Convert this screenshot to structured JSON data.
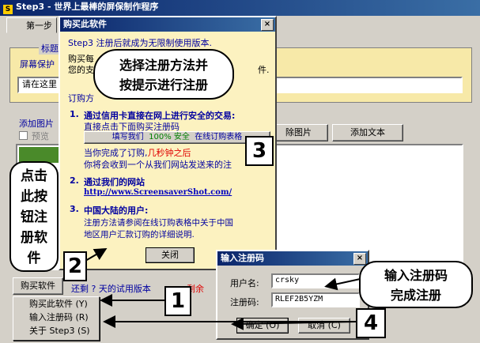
{
  "main_window": {
    "title": "Step3 - 世界上最棒的屏保制作程序",
    "step_tab": "第一步",
    "group_label": "标题",
    "saver_label": "屏幕保护",
    "title_input_value": "请在这里",
    "add_image_label": "添加图片",
    "preview_checkbox_label": "预览",
    "delete_image_button": "除图片",
    "add_text_button": "添加文本",
    "buy_button": "购买软件",
    "trial_text": "还剩 ? 天的试用版本",
    "trial_suffix": "剩余"
  },
  "buy_dialog": {
    "title": "购买此软件",
    "intro": "Step3 注册后就成为无限制使用版本.",
    "buy_line1": "购买每",
    "buy_line2": "您的支",
    "buy_line2_end": "件.",
    "methods_label": "订购方",
    "item1_num": "1.",
    "item1_title": "通过信用卡直接在网上进行安全的交易:",
    "item1_sub": "直接点击下面购买注册码",
    "order_link": "填写我们  100% 安全  在线订购表格",
    "order_link_part1": "填写我们",
    "order_link_part2": "100% 安全",
    "order_link_part3": "在线订购表格",
    "item1_done": "当你完成了订购,",
    "item1_done_red": "几秒钟之后",
    "item1_receive": "你将会收到一个从我们网站发送来的注",
    "item2_num": "2.",
    "item2_title": "通过我们的网站",
    "website": "http://www.ScreensaverShot.com/",
    "item3_num": "3.",
    "item3_title": "中国大陆的用户:",
    "item3_line1": "注册方法请参阅在线订购表格中关于中国",
    "item3_line2": "地区用户汇款订购的详细说明.",
    "close_button": "关闭"
  },
  "context_menu": {
    "items": [
      {
        "label": "购买此软件 (Y)"
      },
      {
        "label": "输入注册码 (R)"
      },
      {
        "label": "关于  Step3 (S)"
      }
    ]
  },
  "reg_dialog": {
    "title": "输入注册码",
    "username_label": "用户名:",
    "username_value": "crsky",
    "code_label": "注册码:",
    "code_value": "RLEF2B5YZM",
    "ok_button": "确定 (O)",
    "cancel_button": "取消 (C)"
  },
  "annotations": {
    "callout_top": [
      "选择注册方法并",
      "按提示进行注册"
    ],
    "callout_left": [
      "点击",
      "此按",
      "钮注",
      "册软",
      "件"
    ],
    "callout_right": [
      "输入注册码",
      "完成注册"
    ],
    "num1": "1",
    "num2": "2",
    "num3": "3",
    "num4": "4"
  },
  "icons": {
    "app_icon": "S",
    "close_x": "×"
  },
  "colors": {
    "titlebar": "#0a246a",
    "dialog_bg": "#fcf2c0",
    "link_blue": "#0000c0",
    "green": "#008000",
    "red": "#e00000"
  }
}
